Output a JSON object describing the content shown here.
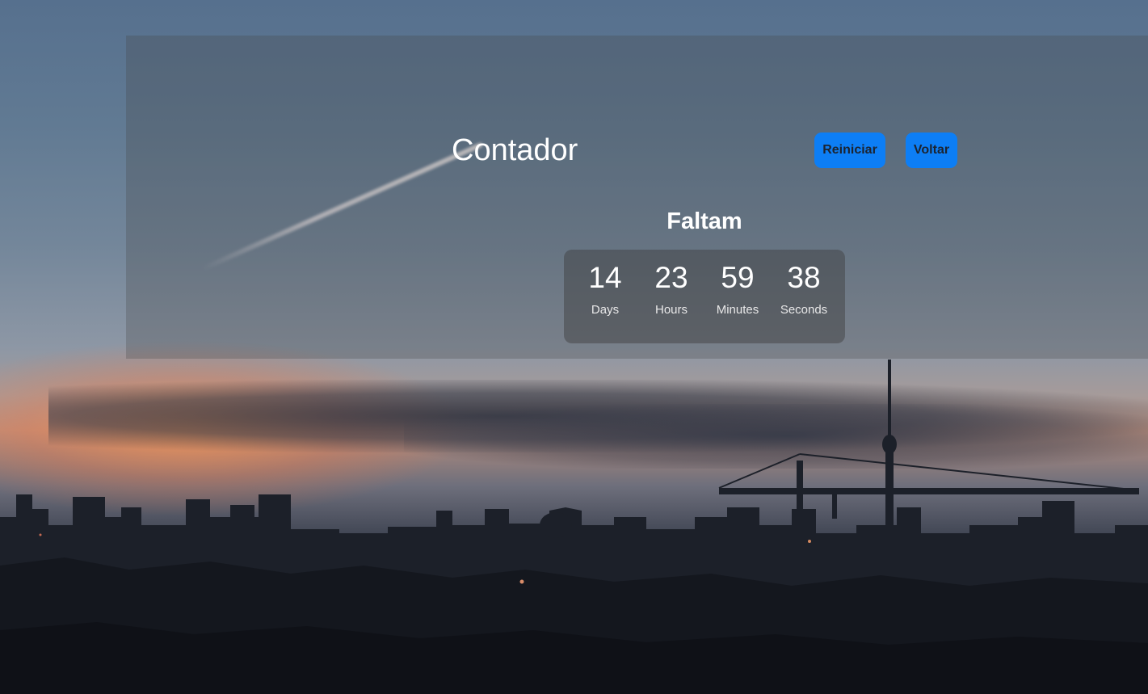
{
  "header": {
    "title": "Contador",
    "buttons": {
      "restart_label": "Reiniciar",
      "back_label": "Voltar"
    }
  },
  "countdown": {
    "heading": "Faltam",
    "units": [
      {
        "value": "14",
        "label": "Days"
      },
      {
        "value": "23",
        "label": "Hours"
      },
      {
        "value": "59",
        "label": "Minutes"
      },
      {
        "value": "38",
        "label": "Seconds"
      }
    ]
  },
  "colors": {
    "button_bg": "#0d7ef5",
    "text": "#ffffff"
  },
  "background": {
    "description_icon": "city-skyline-sunset-image"
  }
}
